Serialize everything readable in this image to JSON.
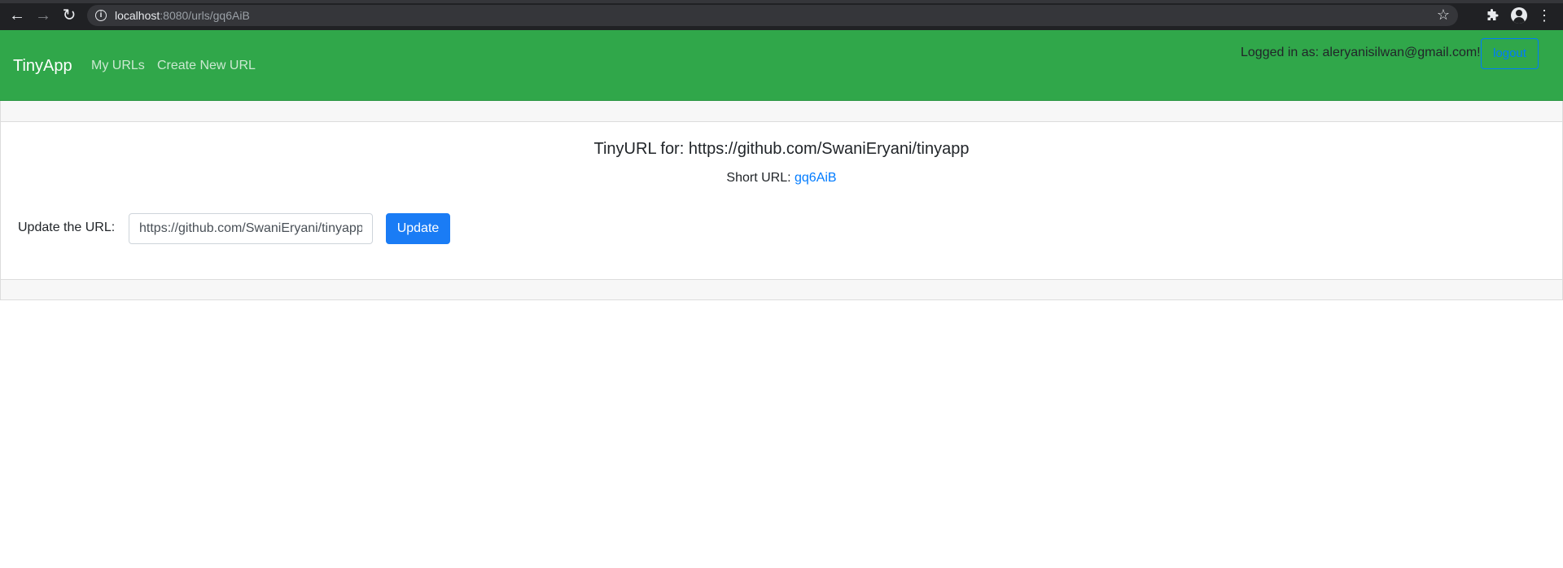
{
  "browser": {
    "url_host": "localhost",
    "url_path": ":8080/urls/gq6AiB",
    "back_icon": "arrow-left-icon",
    "forward_icon": "arrow-right-icon",
    "reload_icon": "reload-icon",
    "info_icon": "info-icon",
    "star_icon": "star-icon",
    "extensions_icon": "puzzle-icon",
    "profile_icon": "profile-icon",
    "menu_icon": "more-vert-icon"
  },
  "navbar": {
    "brand": "TinyApp",
    "links": [
      "My URLs",
      "Create New URL"
    ],
    "login_text": "Logged in as: aleryanisilwan@gmail.com!",
    "logout_label": "logout",
    "background": "#30a74a"
  },
  "card": {
    "title": "TinyURL for: https://github.com/SwaniEryani/tinyapp",
    "short_url_label": "Short URL: ",
    "short_url_value": "gq6AiB",
    "update_label": "Update the URL:",
    "input_value": "https://github.com/SwaniEryani/tinyapp",
    "update_button": "Update"
  },
  "colors": {
    "link": "#007bff",
    "primary_button": "#1a7cf5"
  }
}
